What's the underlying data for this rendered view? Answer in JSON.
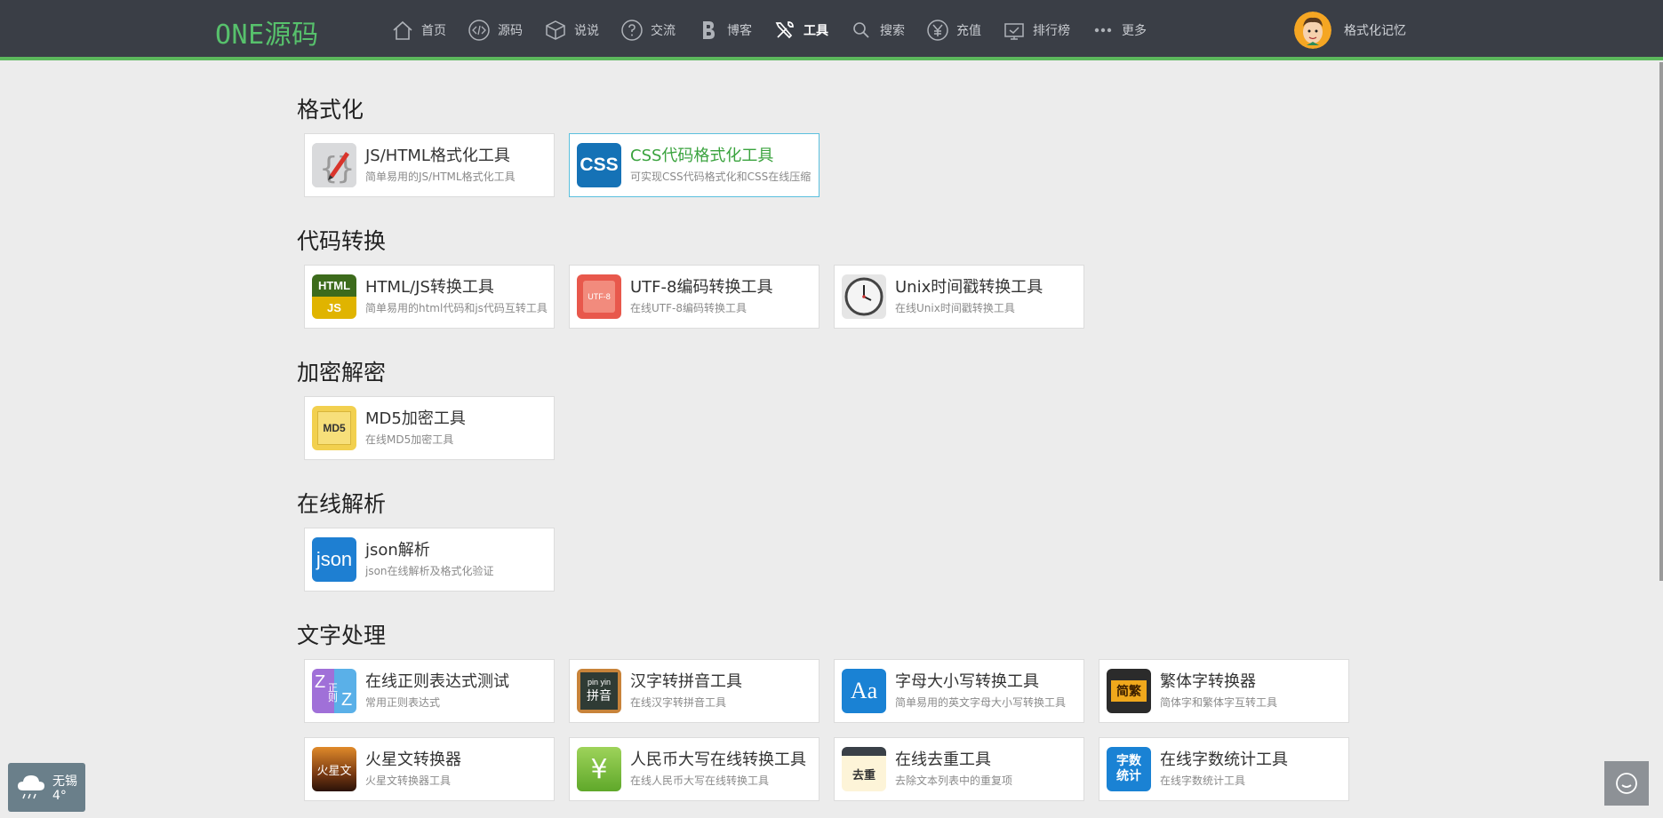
{
  "header": {
    "logo": "ONE源码",
    "nav": [
      {
        "label": "首页",
        "icon": "home-icon"
      },
      {
        "label": "源码",
        "icon": "code-icon"
      },
      {
        "label": "说说",
        "icon": "cube-icon"
      },
      {
        "label": "交流",
        "icon": "question-icon"
      },
      {
        "label": "博客",
        "icon": "blog-b-icon"
      },
      {
        "label": "工具",
        "icon": "tools-icon",
        "active": true
      },
      {
        "label": "搜索",
        "icon": "search-icon"
      },
      {
        "label": "充值",
        "icon": "yen-icon"
      },
      {
        "label": "排行榜",
        "icon": "ranking-icon"
      },
      {
        "label": "更多",
        "icon": "more-dots-icon"
      }
    ],
    "user": {
      "name": "格式化记忆"
    }
  },
  "sections": [
    {
      "title": "格式化",
      "tools": [
        {
          "title": "JS/HTML格式化工具",
          "desc": "简单易用的JS/HTML格式化工具",
          "icon": "js-html-format-icon"
        },
        {
          "title": "CSS代码格式化工具",
          "desc": "可实现CSS代码格式化和CSS在线压缩",
          "icon": "css-icon",
          "highlight": true
        }
      ]
    },
    {
      "title": "代码转换",
      "tools": [
        {
          "title": "HTML/JS转换工具",
          "desc": "简单易用的html代码和js代码互转工具",
          "icon": "html-js-icon"
        },
        {
          "title": "UTF-8编码转换工具",
          "desc": "在线UTF-8编码转换工具",
          "icon": "utf8-icon"
        },
        {
          "title": "Unix时间戳转换工具",
          "desc": "在线Unix时间戳转换工具",
          "icon": "clock-icon"
        }
      ]
    },
    {
      "title": "加密解密",
      "tools": [
        {
          "title": "MD5加密工具",
          "desc": "在线MD5加密工具",
          "icon": "md5-icon"
        }
      ]
    },
    {
      "title": "在线解析",
      "tools": [
        {
          "title": "json解析",
          "desc": "json在线解析及格式化验证",
          "icon": "json-icon"
        }
      ]
    },
    {
      "title": "文字处理",
      "tools": [
        {
          "title": "在线正则表达式测试",
          "desc": "常用正则表达式",
          "icon": "regex-icon"
        },
        {
          "title": "汉字转拼音工具",
          "desc": "在线汉字转拼音工具",
          "icon": "pinyin-icon"
        },
        {
          "title": "字母大小写转换工具",
          "desc": "简单易用的英文字母大小写转换工具",
          "icon": "letter-case-icon"
        },
        {
          "title": "繁体字转换器",
          "desc": "简体字和繁体字互转工具",
          "icon": "traditional-chinese-icon"
        },
        {
          "title": "火星文转换器",
          "desc": "火星文转换器工具",
          "icon": "martian-text-icon"
        },
        {
          "title": "人民币大写在线转换工具",
          "desc": "在线人民币大写在线转换工具",
          "icon": "rmb-icon"
        },
        {
          "title": "在线去重工具",
          "desc": "去除文本列表中的重复项",
          "icon": "dedupe-icon"
        },
        {
          "title": "在线字数统计工具",
          "desc": "在线字数统计工具",
          "icon": "word-count-icon"
        }
      ]
    }
  ],
  "icon_text": {
    "css": "CSS",
    "html": "HTML",
    "js": "JS",
    "utf8": "UTF-8",
    "md5": "MD5",
    "json": "json",
    "regex_z1": "Z",
    "regex_mid": "正则",
    "regex_z2": "Z",
    "pinyin_top": "pin yin",
    "pinyin_bottom": "拼音",
    "aa": "Aa",
    "fan_jian": "简繁",
    "martian": "火星文",
    "yen": "¥",
    "dedupe": "去重",
    "wordcount": "字数统计"
  },
  "weather": {
    "city": "无锡",
    "temp": "4°"
  },
  "colors": {
    "topbar": "#3a3e46",
    "accent_green": "#5cb85c",
    "logo_green": "#57c16c",
    "highlight_border": "#5bc0de",
    "page_bg": "#ececec"
  }
}
